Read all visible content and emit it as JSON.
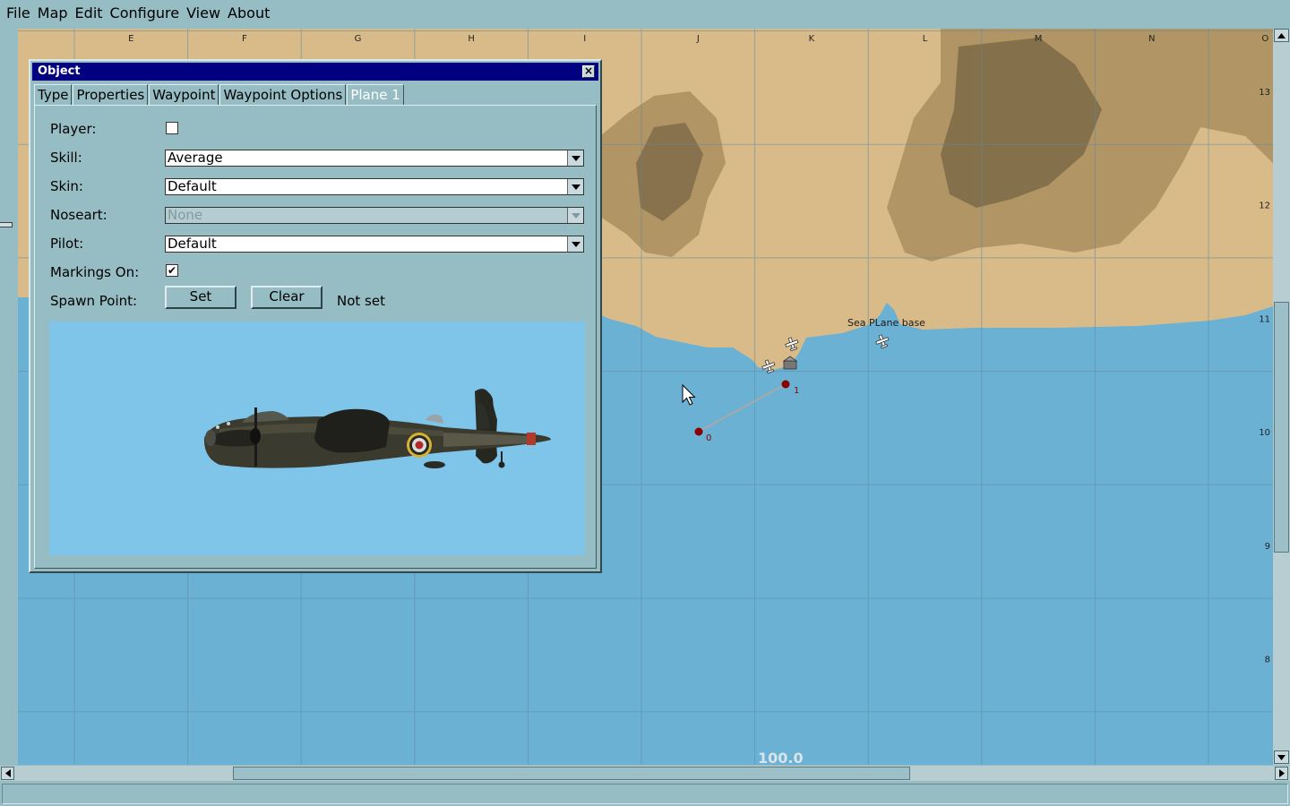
{
  "menu": [
    "File",
    "Map",
    "Edit",
    "Configure",
    "View",
    "About"
  ],
  "map": {
    "col_labels": [
      "E",
      "F",
      "G",
      "H",
      "I",
      "J",
      "K",
      "L",
      "M",
      "N",
      "O"
    ],
    "row_labels": [
      "13",
      "12",
      "11",
      "10",
      "9",
      "8"
    ],
    "base_label": "Sea PLane base",
    "waypoints": [
      "0",
      "1"
    ],
    "scale_text": "100.0",
    "land_color": "#d9bb8a",
    "sea_color": "#6bb1d4",
    "waypoint_color": "#8a0000"
  },
  "dialog": {
    "title": "Object",
    "close_label": "×",
    "tabs": [
      "Type",
      "Properties",
      "Waypoint",
      "Waypoint Options",
      "Plane 1"
    ],
    "active_tab": "Plane 1",
    "fields": {
      "player_label": "Player:",
      "player_checked": false,
      "skill_label": "Skill:",
      "skill_value": "Average",
      "skin_label": "Skin:",
      "skin_value": "Default",
      "noseart_label": "Noseart:",
      "noseart_value": "None",
      "pilot_label": "Pilot:",
      "pilot_value": "Default",
      "markings_label": "Markings On:",
      "markings_checked": true,
      "checkmark": "✔",
      "spawn_label": "Spawn Point:",
      "set_label": "Set",
      "clear_label": "Clear",
      "spawn_status": "Not set"
    }
  }
}
